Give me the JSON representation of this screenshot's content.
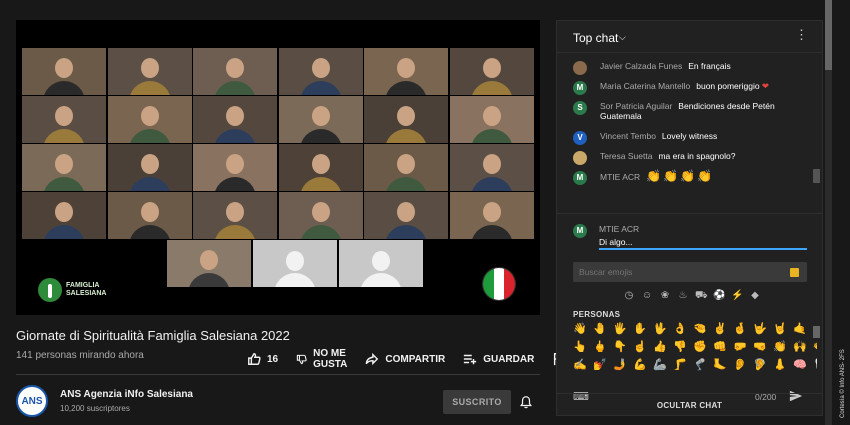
{
  "video": {
    "logo_text": "FAMIGLIA\nSALESIANA",
    "flag_colors": [
      "#1e9b3a",
      "#ffffff",
      "#d9232d"
    ]
  },
  "meta": {
    "title": "Giornate di Spiritualità Famiglia Salesiana 2022",
    "views": "141 personas mirando ahora",
    "like_count": "16",
    "dislike_label_1": "NO ME",
    "dislike_label_2": "GUSTA",
    "share_label": "COMPARTIR",
    "save_label": "GUARDAR"
  },
  "channel": {
    "avatar_text": "ANS",
    "name": "ANS Agenzia iNfo Salesiana",
    "subscribers": "10,200 suscriptores",
    "subscribe_label": "SUSCRITO"
  },
  "chat": {
    "header_title": "Top chat",
    "messages": [
      {
        "author": "Javier Calzada Funes",
        "text": "En français",
        "avatar": "",
        "avatar_color": "#8a6a4a"
      },
      {
        "author": "Maria Caterina Mantello",
        "text": "buon pomeriggio",
        "avatar": "M",
        "avatar_color": "#2b7a4b",
        "suffix": "❤"
      },
      {
        "author": "Sor Patricia Aguilar",
        "text": "Bendiciones desde Petén Guatemala",
        "avatar": "S",
        "avatar_color": "#2b7a4b"
      },
      {
        "author": "Vincent Tembo",
        "text": "Lovely witness",
        "avatar": "V",
        "avatar_color": "#1f5fbf"
      },
      {
        "author": "Teresa Suetta",
        "text": "ma era in spagnolo?",
        "avatar": "",
        "avatar_color": "#c9a86a"
      },
      {
        "author": "MTIE ACR",
        "text": "👏👏👏👏",
        "avatar": "M",
        "avatar_color": "#2b7a4b"
      }
    ],
    "me_avatar": "M",
    "me_name": "MTIE ACR",
    "input_value": "Di algo...",
    "emoji_search_placeholder": "Buscar emojis",
    "emoji_category_label": "PERSONAS",
    "emoji_rows": [
      [
        "👋",
        "🤚",
        "🖐",
        "✋",
        "🖖",
        "👌",
        "🤏",
        "✌",
        "🤞",
        "🤟",
        "🤘",
        "🤙",
        "👈",
        "👉"
      ],
      [
        "👆",
        "🖕",
        "👇",
        "☝",
        "👍",
        "👎",
        "✊",
        "👊",
        "🤛",
        "🤜",
        "👏",
        "🙌",
        "👐",
        "🙏"
      ],
      [
        "✍",
        "💅",
        "🤳",
        "💪",
        "🦾",
        "🦵",
        "🦿",
        "🦶",
        "👂",
        "🦻",
        "👃",
        "🧠",
        "🦷",
        "🦴"
      ]
    ],
    "char_counter": "0/200",
    "hide_chat_label": "OCULTAR CHAT"
  },
  "credit": "Cortesía © Info ANS- 2FS"
}
